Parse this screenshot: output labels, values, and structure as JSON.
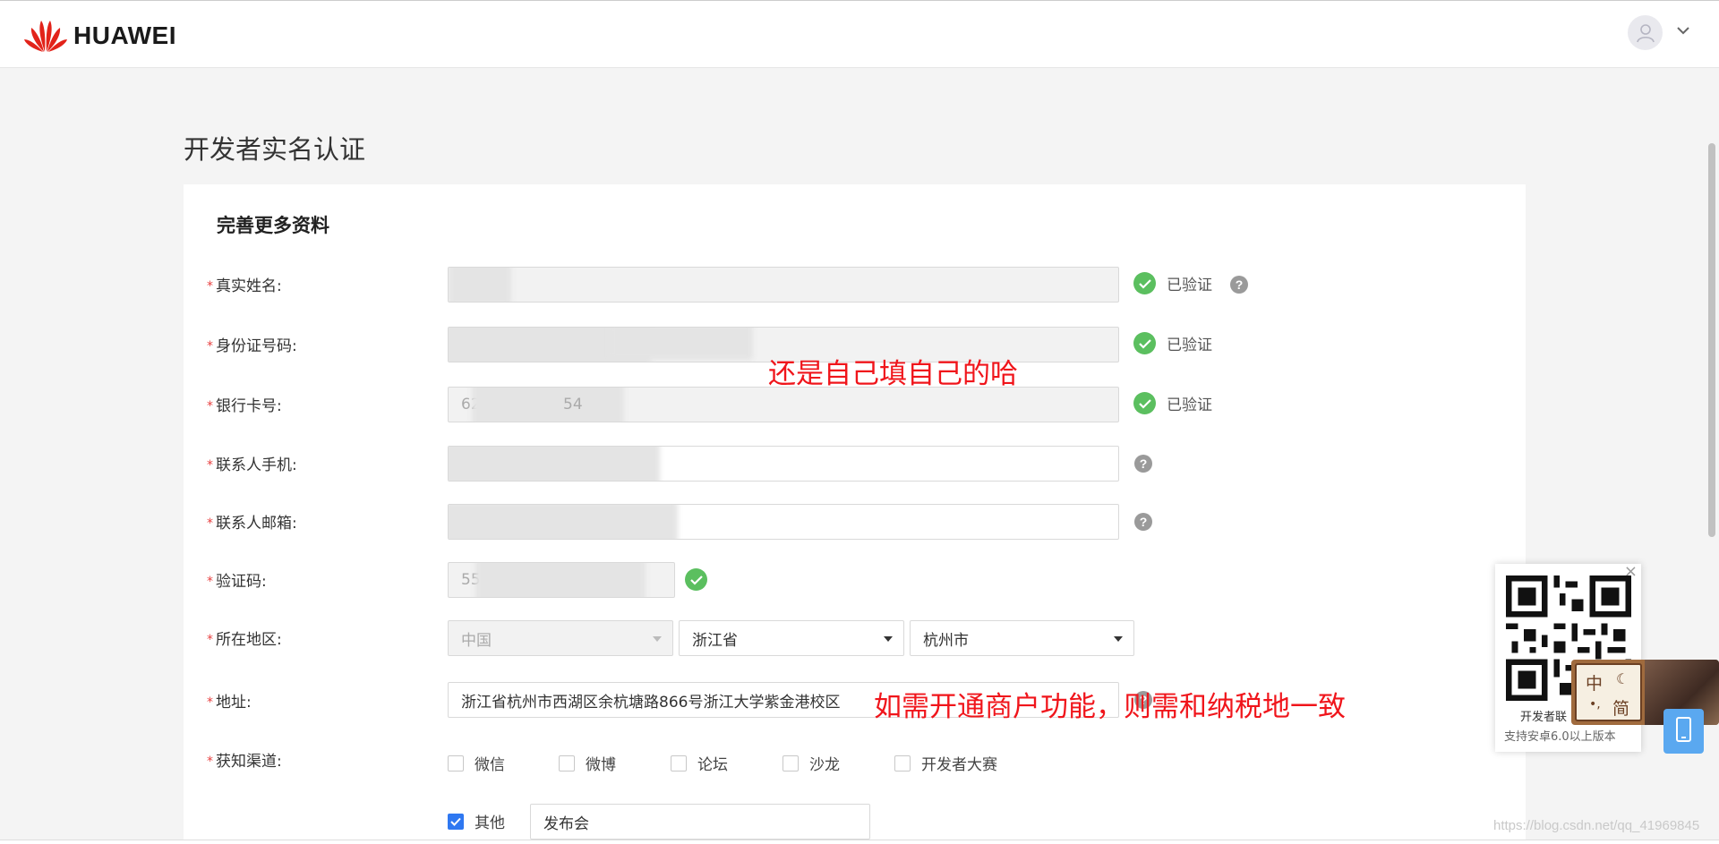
{
  "header": {
    "brand": "HUAWEI",
    "logo_icon": "huawei-petal-logo",
    "avatar_icon": "user-icon",
    "menu_icon": "chevron-down-icon"
  },
  "page": {
    "title": "开发者实名认证"
  },
  "form": {
    "section_title": "完善更多资料",
    "required_mark": "*",
    "real_name": {
      "label": "真实姓名:",
      "status": "已验证"
    },
    "id_number": {
      "label": "身份证号码:",
      "status": "已验证"
    },
    "bank_card": {
      "label": "银行卡号:",
      "value": "62",
      "value_tail": "54",
      "status": "已验证"
    },
    "phone": {
      "label": "联系人手机:"
    },
    "email": {
      "label": "联系人邮箱:"
    },
    "captcha": {
      "label": "验证码:",
      "value": "55"
    },
    "region": {
      "label": "所在地区:",
      "country": "中国",
      "province": "浙江省",
      "city": "杭州市"
    },
    "address": {
      "label": "地址:",
      "value": "浙江省杭州市西湖区余杭塘路866号浙江大学紫金港校区"
    },
    "channel": {
      "label": "获知渠道:",
      "options": [
        "微信",
        "微博",
        "论坛",
        "沙龙",
        "开发者大赛"
      ],
      "other_label": "其他",
      "other_value": "发布会",
      "other_checked": true
    },
    "help_symbol": "?"
  },
  "annotations": {
    "note1": "还是自己填自己的哈",
    "note2": "如需开通商户功能，则需和纳税地一致"
  },
  "qr_panel": {
    "close": "×",
    "title": "开发者联",
    "subtitle": "支持安卓6.0以上版本"
  },
  "ime": {
    "key1": "中",
    "key2": "简"
  },
  "watermark": "https://blog.csdn.net/qq_41969845",
  "colors": {
    "required": "#e84141",
    "verified": "#5bbf5f",
    "checkbox": "#2f78f1",
    "annotation": "#f0151b"
  }
}
